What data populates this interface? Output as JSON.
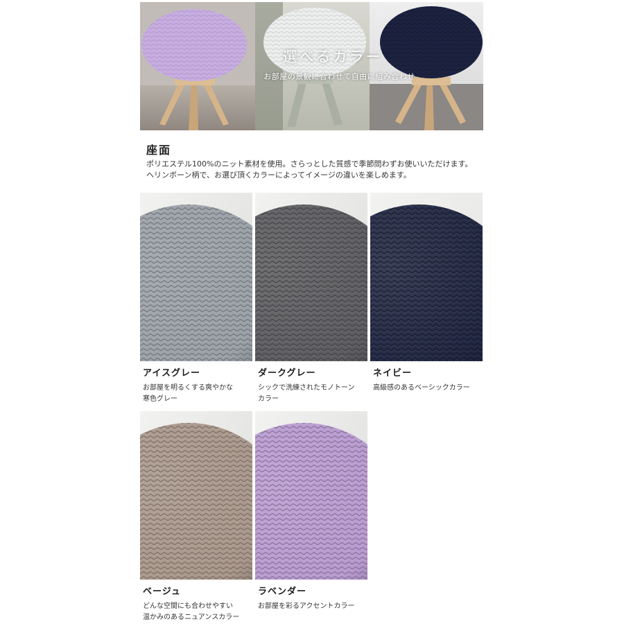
{
  "hero": {
    "title": "選べるカラー",
    "subtitle": "お部屋の景観に合わせて自由に組み合わせ"
  },
  "section": {
    "title": "座面",
    "desc_line1": "ポリエステル100%のニット素材を使用。さらっとした質感で季節問わずお使いいただけます。",
    "desc_line2": "ヘリンボーン柄で、お選び頂くカラーによってイメージの違いを楽しめます。"
  },
  "swatches": [
    {
      "name": "アイスグレー",
      "desc": "お部屋を明るくする爽やかな\n寒色グレー",
      "color": "#9aa0a6"
    },
    {
      "name": "ダークグレー",
      "desc": "シックで洗練されたモノトーン\nカラー",
      "color": "#5b5a5e"
    },
    {
      "name": "ネイビー",
      "desc": "高級感のあるベーシックカラー",
      "color": "#1f2540"
    },
    {
      "name": "ベージュ",
      "desc": "どんな空間にも合わせやすい\n温かみのあるニュアンスカラー",
      "color": "#a8968a"
    },
    {
      "name": "ラベンダー",
      "desc": "お部屋を彩るアクセントカラー",
      "color": "#b89ad0"
    }
  ]
}
